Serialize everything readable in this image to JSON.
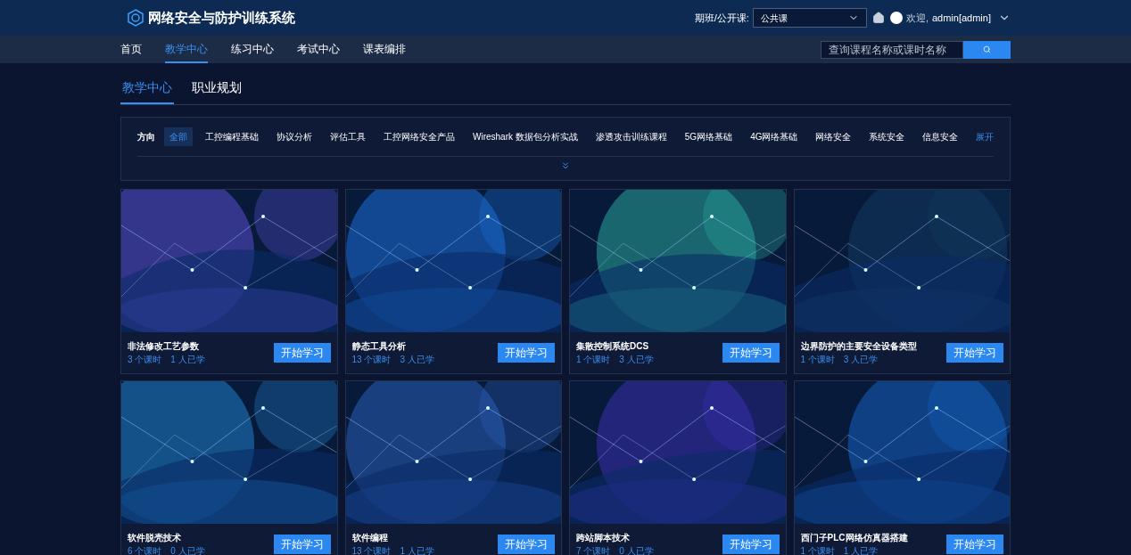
{
  "app": {
    "title": "网络安全与防护训练系统"
  },
  "header": {
    "class_label": "期班/公开课:",
    "class_select": "公共课",
    "welcome": "欢迎,",
    "user": "admin[admin]"
  },
  "nav": [
    {
      "label": "首页",
      "selected": false
    },
    {
      "label": "教学中心",
      "selected": true
    },
    {
      "label": "练习中心",
      "selected": false
    },
    {
      "label": "考试中心",
      "selected": false
    },
    {
      "label": "课表编排",
      "selected": false
    }
  ],
  "search": {
    "placeholder": "查询课程名称或课时名称"
  },
  "tabs": [
    {
      "label": "教学中心",
      "selected": true
    },
    {
      "label": "职业规划",
      "selected": false
    }
  ],
  "filter": {
    "label": "方向",
    "expand": "展开",
    "options": [
      {
        "label": "全部",
        "selected": true
      },
      {
        "label": "工控编程基础",
        "selected": false
      },
      {
        "label": "协议分析",
        "selected": false
      },
      {
        "label": "评估工具",
        "selected": false
      },
      {
        "label": "工控网络安全产品",
        "selected": false
      },
      {
        "label": "Wireshark 数据包分析实战",
        "selected": false
      },
      {
        "label": "渗透攻击训练课程",
        "selected": false
      },
      {
        "label": "5G网络基础",
        "selected": false
      },
      {
        "label": "4G网络基础",
        "selected": false
      },
      {
        "label": "网络安全",
        "selected": false
      },
      {
        "label": "系统安全",
        "selected": false
      },
      {
        "label": "信息安全",
        "selected": false
      }
    ]
  },
  "courses": [
    {
      "title": "非法修改工艺参数",
      "lessons": "3 个课时",
      "learners": "1 人已学",
      "button": "开始学习"
    },
    {
      "title": "静态工具分析",
      "lessons": "13 个课时",
      "learners": "3 人已学",
      "button": "开始学习"
    },
    {
      "title": "集散控制系统DCS",
      "lessons": "1 个课时",
      "learners": "3 人已学",
      "button": "开始学习"
    },
    {
      "title": "边界防护的主要安全设备类型",
      "lessons": "1 个课时",
      "learners": "3 人已学",
      "button": "开始学习"
    },
    {
      "title": "软件脱壳技术",
      "lessons": "6 个课时",
      "learners": "0 人已学",
      "button": "开始学习"
    },
    {
      "title": "软件编程",
      "lessons": "13 个课时",
      "learners": "1 人已学",
      "button": "开始学习"
    },
    {
      "title": "跨站脚本技术",
      "lessons": "7 个课时",
      "learners": "0 人已学",
      "button": "开始学习"
    },
    {
      "title": "西门子PLC网络仿真器搭建",
      "lessons": "1 个课时",
      "learners": "1 人已学",
      "button": "开始学习"
    }
  ]
}
